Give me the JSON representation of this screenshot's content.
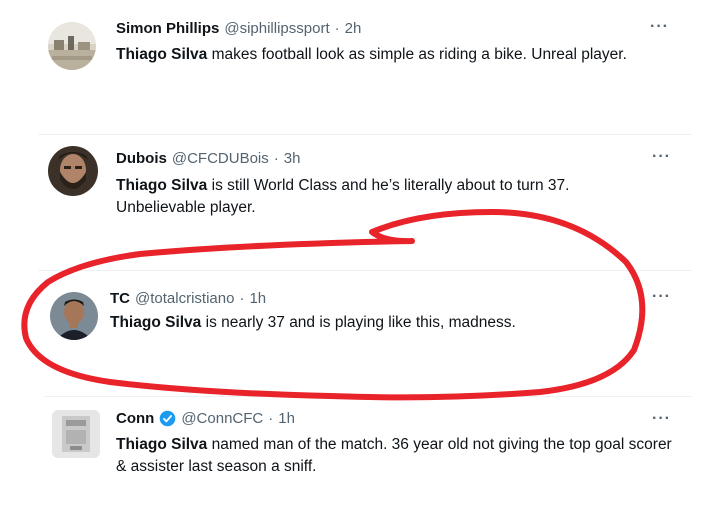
{
  "tweets": [
    {
      "name": "Simon Phillips",
      "handle": "@siphillipssport",
      "separator": "·",
      "time": "2h",
      "highlight": "Thiago Silva",
      "text": " makes football look as simple as riding a bike. Unreal player.",
      "more": "···",
      "avatar_icon": "landscape-photo-avatar"
    },
    {
      "name": "Dubois",
      "handle": "@CFCDUBois",
      "separator": "·",
      "time": "3h",
      "highlight": "Thiago Silva",
      "text": " is still World Class and he’s literally about to turn 37. Unbelievable player.",
      "more": "···",
      "avatar_icon": "bearded-man-avatar"
    },
    {
      "name": "TC",
      "handle": "@totalcristiano",
      "separator": "·",
      "time": "1h",
      "highlight": "Thiago Silva",
      "text": " is nearly 37 and is playing like this, madness.",
      "more": "···",
      "avatar_icon": "footballer-avatar"
    },
    {
      "name": "Conn",
      "handle": "@ConnCFC",
      "separator": "·",
      "time": "1h",
      "highlight": "Thiago Silva",
      "text": " named man of the match. 36 year old not giving the top goal scorer & assister last season a sniff.",
      "more": "···",
      "avatar_icon": "trophy-avatar",
      "verified": true
    }
  ],
  "colors": {
    "text": "#0f1419",
    "muted": "#536471",
    "verified": "#1d9bf0",
    "annotation": "#e8232a"
  }
}
